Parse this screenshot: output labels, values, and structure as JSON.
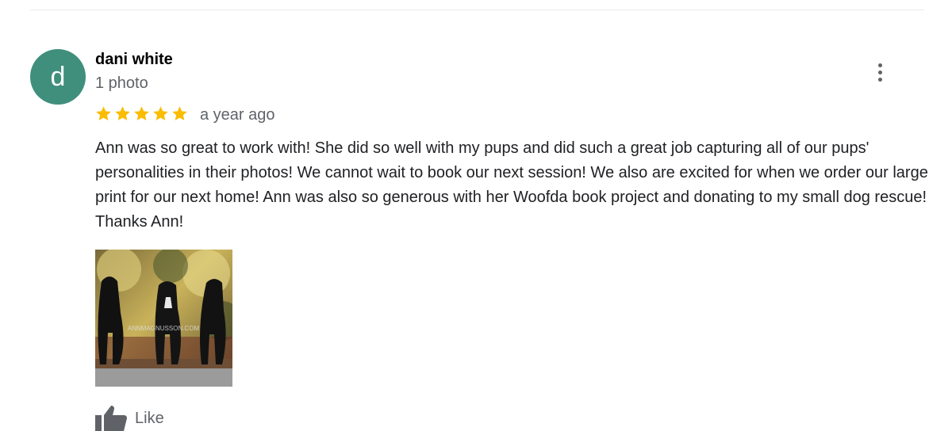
{
  "review": {
    "avatar_initial": "d",
    "avatar_color": "#3f8f7c",
    "reviewer_name": "dani white",
    "reviewer_meta": "1 photo",
    "rating": 5,
    "star_color": "#fbbc04",
    "time_ago": "a year ago",
    "text": "Ann was so great to work with! She did so well with my pups and did such a great job capturing all of our pups' personalities in their photos! We cannot wait to book our next session! We also are excited for when we order our large print for our next home! Ann was also so generous with her Woofda book project and donating to my small dog rescue! Thanks Ann!",
    "photo_watermark": "ANNMAGNUSSON.COM",
    "more_icon": "more-vert-icon",
    "like_icon": "thumbs-up-icon",
    "like_label": "Like"
  }
}
